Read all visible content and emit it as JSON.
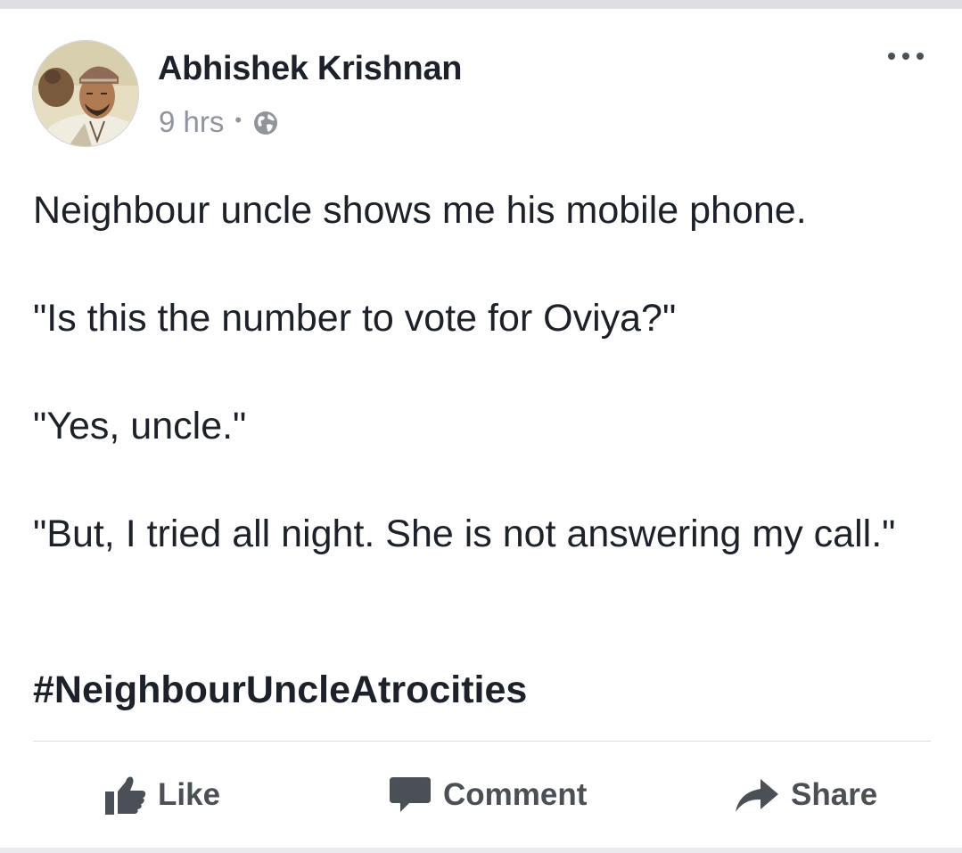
{
  "post": {
    "author": "Abhishek Krishnan",
    "timestamp": "9 hrs",
    "separator": "•",
    "audience_icon": "globe-icon",
    "more_icon": "more-options-icon",
    "paragraphs": [
      "Neighbour uncle shows me his mobile phone.",
      "\"Is this the number to vote for Oviya?\"",
      "\"Yes, uncle.\"",
      "\"But, I tried all night. She is not answering my call.\""
    ],
    "hashtag": "#NeighbourUncleAtrocities"
  },
  "actions": {
    "like_label": "Like",
    "like_icon": "thumbs-up-icon",
    "comment_label": "Comment",
    "comment_icon": "speech-bubble-icon",
    "share_label": "Share",
    "share_icon": "share-arrow-icon"
  },
  "colors": {
    "text": "#1d2129",
    "secondary_text": "#90949c",
    "action_text": "#4b4f56",
    "divider": "#dadde1"
  }
}
